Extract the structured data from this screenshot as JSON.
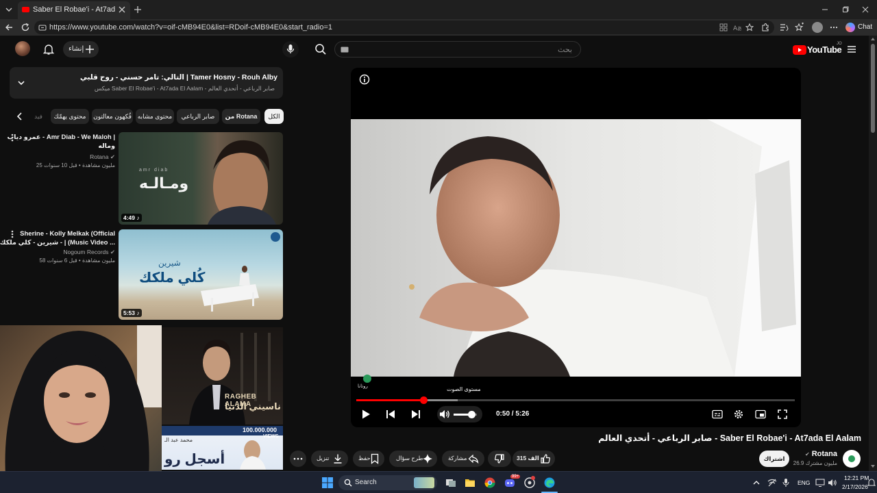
{
  "browser": {
    "tab_title": "Saber El Robae'i - At7ada El Aalam",
    "url": "https://www.youtube.com/watch?v=oif-cMB94E0&list=RDoif-cMB94E0&start_radio=1",
    "chat_label": "Chat"
  },
  "header": {
    "create_label": "إنشاء",
    "search_placeholder": "بحث",
    "logo_text": "YouTube",
    "logo_region": "JO"
  },
  "mix": {
    "title": "التالي: تامر حسني - روح قلبي | Tamer Hosny - Rouh Alby",
    "subtitle": "ميكس Saber El Robae'i - At7ada El Aalam - صابر الرباعي - أتحدي العالم"
  },
  "chips": [
    "الكل",
    "من Rotana",
    "صابر الرباعي",
    "محتوى مشابه",
    "فُكهون معالتون",
    "محتوى يهمّك",
    "فيد"
  ],
  "related": [
    {
      "title_line1": "عمرو دياب - Amr Diab - We Maloh |",
      "title_line2": "وماله",
      "channel": "Rotana",
      "meta": "25 مليون مشاهدة • قبل 10 سنوات",
      "duration": "4:49",
      "thumb_text": "ومـالـه",
      "thumb_small": "amr diab"
    },
    {
      "title_line1": "Sherine - Kolly Melkak (Official",
      "title_line2": "شيرين - كلي ملكك - | (Music Video ...",
      "channel": "Nogoum Records",
      "meta": "58 مليون مشاهدة • قبل 6 سنوات",
      "duration": "5:53",
      "thumb_text": "كُلي ملكك",
      "thumb_small": "شيرين"
    },
    {
      "thumb_text_en": "RAGHEB ALAMA",
      "thumb_text": "ناسيني الدنيا"
    },
    {
      "thumb_views": "100.000.000",
      "thumb_views_label": "VIEWS",
      "thumb_text": "أسجل رو",
      "thumb_small": "محمد عبد الـ"
    }
  ],
  "player": {
    "current_time": "0:50",
    "duration": "5:26",
    "time_display": "0:50 / 5:26",
    "progress_fraction": 0.153,
    "volume_tooltip": "مستوى الصوت",
    "volume_fraction": 0.75,
    "channel_watermark": "روتانا"
  },
  "video": {
    "title": "صابر الرباعي - أتحدي العالم - Saber El Robae'i - At7ada El Aalam",
    "channel": "Rotana",
    "subscribers": "26.9 مليون مشترك",
    "subscribe_label": "اشتراك",
    "likes": "315 الف",
    "share_label": "مشاركة",
    "ask_label": "طرح سؤال",
    "save_label": "حفظ",
    "download_label": "تنزيل"
  },
  "taskbar": {
    "search_label": "Search",
    "lang": "ENG",
    "time": "12:21 PM",
    "date": "2/17/2026",
    "badge": "99+"
  },
  "colors": {
    "accent_red": "#ff0000",
    "bg": "#0f0f0f",
    "surface": "#272727"
  }
}
